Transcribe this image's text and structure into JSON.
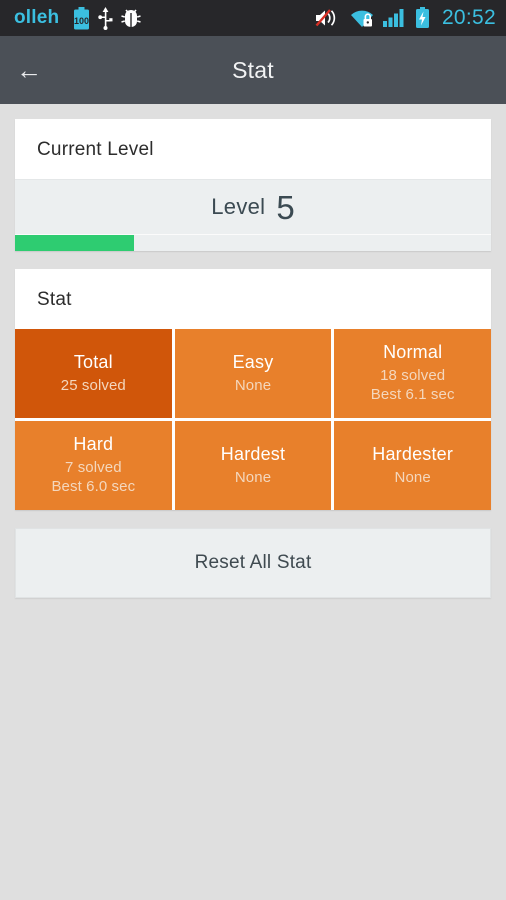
{
  "status_bar": {
    "carrier": "olleh",
    "battery_level_text": "100",
    "icons": [
      "battery-icon",
      "usb-icon",
      "bug-icon",
      "volume-muted-icon",
      "wifi-secured-icon",
      "signal-bars-icon",
      "battery-charging-icon"
    ],
    "clock": "20:52",
    "accent_color": "#3bbfe0",
    "background_color": "#27272a"
  },
  "app_bar": {
    "back_label": "←",
    "title": "Stat",
    "background_color": "#4b5057"
  },
  "current_level_card": {
    "title": "Current Level",
    "level_word": "Level",
    "level_number": "5",
    "progress_percent": 25,
    "progress_color": "#2ecc71"
  },
  "stat_card": {
    "title": "Stat",
    "total_color": "#d0560a",
    "cell_color": "#e8802b",
    "rows": [
      [
        {
          "label": "Total",
          "line1": "25 solved",
          "line2": "",
          "highlight": true
        },
        {
          "label": "Easy",
          "line1": "None",
          "line2": "",
          "highlight": false
        },
        {
          "label": "Normal",
          "line1": "18 solved",
          "line2": "Best 6.1 sec",
          "highlight": false
        }
      ],
      [
        {
          "label": "Hard",
          "line1": "7 solved",
          "line2": "Best 6.0 sec",
          "highlight": false
        },
        {
          "label": "Hardest",
          "line1": "None",
          "line2": "",
          "highlight": false
        },
        {
          "label": "Hardester",
          "line1": "None",
          "line2": "",
          "highlight": false
        }
      ]
    ]
  },
  "reset_button": {
    "label": "Reset All Stat"
  }
}
